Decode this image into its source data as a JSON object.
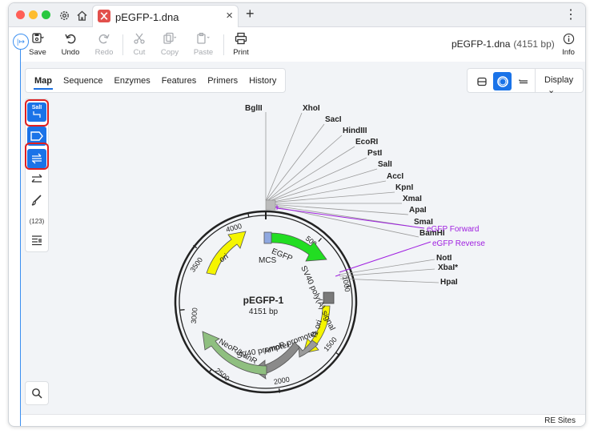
{
  "titlebar": {
    "tab_title": "pEGFP-1.dna",
    "tab_close": "×",
    "new_tab": "+",
    "menu": "⋮"
  },
  "toolbar": {
    "expand_label": "|↦",
    "save_label": "Save",
    "undo_label": "Undo",
    "redo_label": "Redo",
    "cut_label": "Cut",
    "copy_label": "Copy",
    "paste_label": "Paste",
    "print_label": "Print",
    "filename": "pEGFP-1.dna",
    "length": "(4151 bp)",
    "info_label": "Info"
  },
  "view_tabs": [
    "Map",
    "Sequence",
    "Enzymes",
    "Features",
    "Primers",
    "History"
  ],
  "display": {
    "label": "Display"
  },
  "sidebar": {
    "sali_label": "SalI",
    "numbers_label": "(123)"
  },
  "map": {
    "name": "pEGFP-1",
    "length_label": "4151 bp",
    "ticks": [
      "500",
      "1000",
      "1500",
      "2000",
      "2500",
      "3000",
      "3500",
      "4000"
    ],
    "features": {
      "egfp": "EGFP",
      "mcs": "MCS",
      "sv40_polya": "SV40 poly(A) signal",
      "f1_ori": "f1 ori",
      "ampr_promoter": "AmpR promoter",
      "sv40_promoter": "SV40 promoter",
      "neo": "NeoR/KanR",
      "ori": "ori"
    },
    "enzymes_top": [
      "BglII",
      "XhoI",
      "SacI",
      "HindIII",
      "EcoRI",
      "PstI",
      "SalI",
      "AccI",
      "KpnI",
      "XmaI",
      "ApaI",
      "SmaI",
      "BamHI"
    ],
    "primers": [
      "eGFP Forward",
      "eGFP Reverse"
    ],
    "enzymes_right": [
      "NotI",
      "XbaI*",
      "HpaI"
    ]
  },
  "status": {
    "re_sites": "RE Sites"
  },
  "colors": {
    "accent": "#1a73e8",
    "highlight": "#e02020",
    "egfp": "#22dd22",
    "ori": "#f5f500",
    "neo": "#8fbf80",
    "promoter": "#8a8a8a",
    "primer": "#a020e0"
  }
}
